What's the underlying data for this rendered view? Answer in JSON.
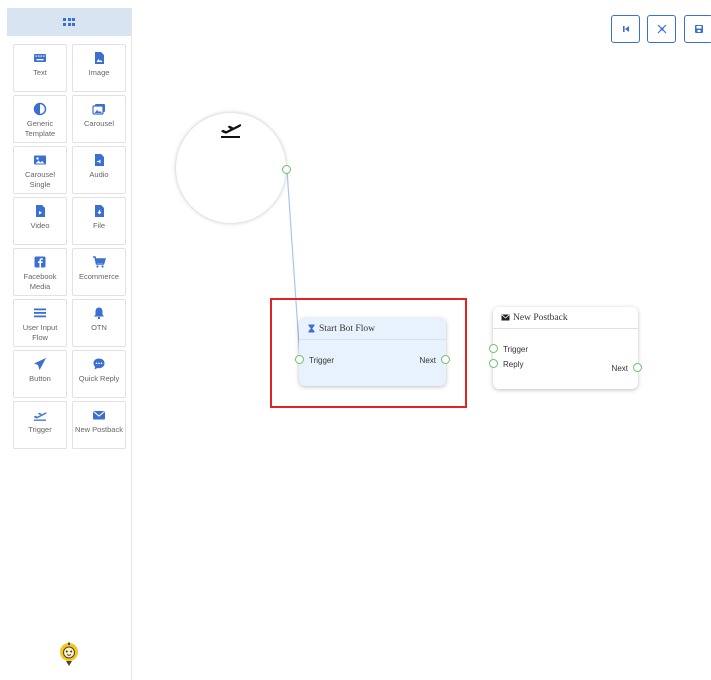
{
  "sidebar": {
    "header_icon": "grid-icon",
    "tools": [
      {
        "label": "Text",
        "icon": "keyboard-icon"
      },
      {
        "label": "Image",
        "icon": "image-file-icon"
      },
      {
        "label": "Generic Template",
        "icon": "half-circle-icon"
      },
      {
        "label": "Carousel",
        "icon": "images-icon"
      },
      {
        "label": "Carousel Single",
        "icon": "picture-icon"
      },
      {
        "label": "Audio",
        "icon": "audio-file-icon"
      },
      {
        "label": "Video",
        "icon": "video-file-icon"
      },
      {
        "label": "File",
        "icon": "download-file-icon"
      },
      {
        "label": "Facebook Media",
        "icon": "facebook-icon"
      },
      {
        "label": "Ecommerce",
        "icon": "cart-icon"
      },
      {
        "label": "User Input Flow",
        "icon": "lines-icon"
      },
      {
        "label": "OTN",
        "icon": "bell-icon"
      },
      {
        "label": "Button",
        "icon": "paper-plane-icon"
      },
      {
        "label": "Quick Reply",
        "icon": "chat-bubble-icon"
      },
      {
        "label": "Trigger",
        "icon": "plane-departure-icon"
      },
      {
        "label": "New Postback",
        "icon": "envelope-icon"
      }
    ]
  },
  "toolbar": {
    "buttons": [
      "first-icon",
      "fit-icon",
      "save-icon"
    ]
  },
  "canvas": {
    "start_icon": "plane-departure-icon",
    "start_bot_flow": {
      "title": "Start Bot Flow",
      "icon": "hourglass-icon",
      "input": "Trigger",
      "output": "Next"
    },
    "new_postback": {
      "title": "New Postback",
      "icon": "envelope-icon",
      "inputs": [
        "Trigger",
        "Reply"
      ],
      "output": "Next"
    }
  },
  "colors": {
    "accent": "#3b6fd1",
    "port": "#6cbf6c",
    "highlight": "#e02323",
    "node_bg": "#e8f2fc",
    "sidebar_head": "#d9e4f2"
  }
}
